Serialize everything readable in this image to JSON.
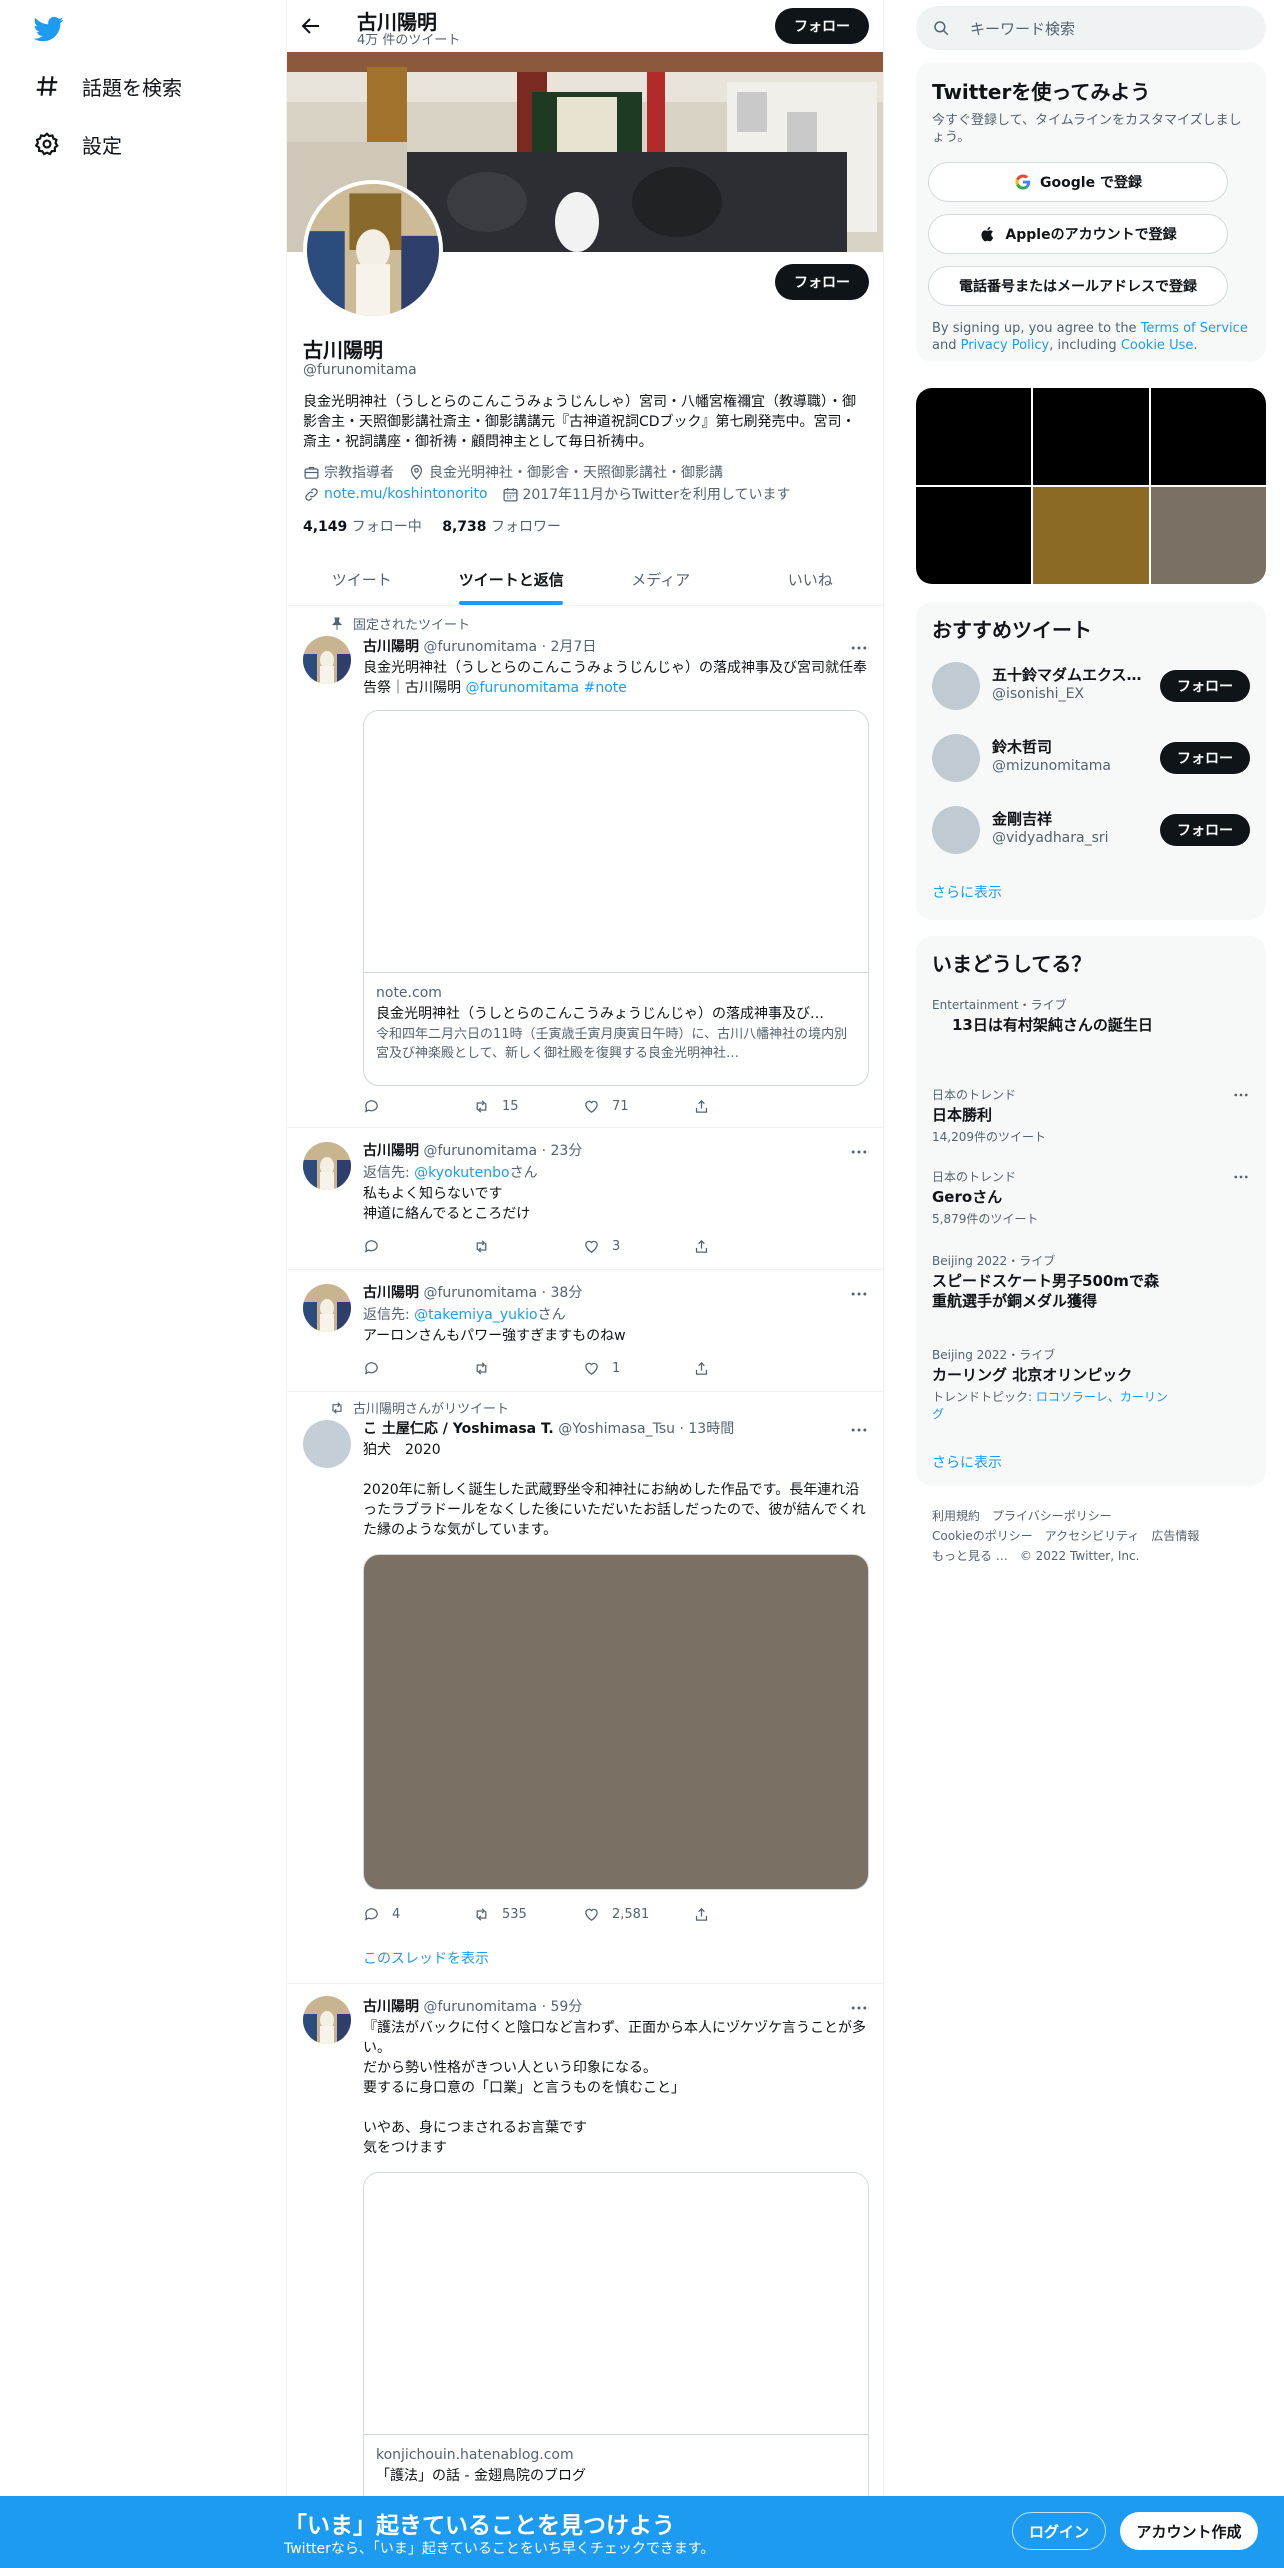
{
  "colors": {
    "accent": "#1d9bf0",
    "text": "#0f1419",
    "muted": "#536471",
    "button_dark": "#0f1419"
  },
  "nav": {
    "logo_icon": "twitter-bird-icon",
    "items": [
      {
        "label": "話題を検索",
        "icon": "hashtag-icon"
      },
      {
        "label": "設定",
        "icon": "gear-icon"
      }
    ]
  },
  "header": {
    "name": "古川陽明",
    "tweet_count": "4万 件のツイート",
    "follow_label": "フォロー"
  },
  "profile": {
    "name": "古川陽明",
    "handle": "@furunomitama",
    "follow_label": "フォロー",
    "bio": "良金光明神社（うしとらのこんこうみょうじんしゃ）宮司・八幡宮権禰宜（教導職）・御影舎主・天照御影講社斎主・御影講講元『古神道祝詞CDブック』第七刷発売中。宮司・斎主・祝詞講座・御祈祷・顧問神主として毎日祈祷中。",
    "category": "宗教指導者",
    "location": "良金光明神社・御影舎・天照御影講社・御影講",
    "website": "note.mu/koshintonorito",
    "joined": "2017年11月からTwitterを利用しています",
    "following_count": "4,149",
    "following_label": "フォロー中",
    "followers_count": "8,738",
    "followers_label": "フォロワー"
  },
  "tabs": [
    {
      "label": "ツイート",
      "active": false
    },
    {
      "label": "ツイートと返信",
      "active": true
    },
    {
      "label": "メディア",
      "active": false
    },
    {
      "label": "いいね",
      "active": false
    }
  ],
  "tweets": [
    {
      "context": "固定されたツイート",
      "name": "古川陽明",
      "handle": "@furunomitama",
      "time": "2月7日",
      "text_plain": "良金光明神社（うしとらのこんこうみょうじんじゃ）の落成神事及び宮司就任奉告祭｜古川陽明 ",
      "text_links": "@furunomitama #note",
      "card": {
        "domain": "note.com",
        "title": "良金光明神社（うしとらのこんこうみょうじんじゃ）の落成神事及び…",
        "desc": "令和四年二月六日の11時（壬寅歳壬寅月庚寅日午時）に、古川八幡神社の境内別宮及び神楽殿として、新しく御社殿を復興する良金光明神社…"
      },
      "replies": "",
      "retweets": "15",
      "likes": "71"
    },
    {
      "name": "古川陽明",
      "handle": "@furunomitama",
      "time": "23分",
      "reply_prefix": "返信先: ",
      "reply_to": "@kyokutenbo",
      "reply_suffix": "さん",
      "line1": "私もよく知らないです",
      "line2": "神道に絡んでるところだけ",
      "replies": "",
      "retweets": "",
      "likes": "3"
    },
    {
      "name": "古川陽明",
      "handle": "@furunomitama",
      "time": "38分",
      "reply_prefix": "返信先: ",
      "reply_to": "@takemiya_yukio",
      "reply_suffix": "さん",
      "line1": "アーロンさんもパワー強すぎますものねw",
      "replies": "",
      "retweets": "",
      "likes": "1"
    },
    {
      "context": "古川陽明さんがリツイート",
      "name": "こ 土屋仁応 / Yoshimasa T.",
      "handle": "@Yoshimasa_Tsu",
      "time": "13時間",
      "line1": "狛犬　2020",
      "line2": "2020年に新しく誕生した武蔵野坐令和神社にお納めした作品です。長年連れ沿ったラブラドールをなくした後にいただいたお話しだったので、彼が結んでくれた縁のような気がしています。",
      "replies": "4",
      "retweets": "535",
      "likes": "2,581",
      "thread": "このスレッドを表示"
    },
    {
      "name": "古川陽明",
      "handle": "@furunomitama",
      "time": "59分",
      "text": "『護法がバックに付くと陰口など言わず、正面から本人にヅケヅケ言うことが多い。\nだから勢い性格がきつい人という印象になる。\n要するに身口意の「口業」と言うものを慎むこと」\n\nいやあ、身につまされるお言葉です\n気をつけます",
      "card": {
        "domain": "konjichouin.hatenablog.com",
        "title": "「護法」の話 - 金翅鳥院のブログ"
      }
    }
  ],
  "right": {
    "search_placeholder": "キーワード検索",
    "signup": {
      "title": "Twitterを使ってみよう",
      "sub": "今すぐ登録して、タイムラインをカスタマイズしましょう。",
      "google": "Google で登録",
      "apple": "Appleのアカウントで登録",
      "phone": "電話番号またはメールアドレスで登録",
      "terms_pre": "By signing up, you agree to the ",
      "terms_link": "Terms of Service",
      "terms_mid": " and ",
      "privacy_link": "Privacy Policy",
      "terms_mid2": ", including ",
      "cookie_link": "Cookie Use",
      "terms_end": "."
    },
    "recommend": {
      "title": "おすすめツイート",
      "follow_label": "フォロー",
      "users": [
        {
          "name": "五十鈴マダムエクス…",
          "handle": "@isonishi_EX"
        },
        {
          "name": "鈴木哲司",
          "handle": "@mizunomitama"
        },
        {
          "name": "金剛吉祥",
          "handle": "@vidyadhara_sri"
        }
      ],
      "more": "さらに表示"
    },
    "trends": {
      "title": "いまどうしてる？",
      "items": [
        {
          "category": "Entertainment・ライブ",
          "title": "13日は有村架純さんの誕生日"
        },
        {
          "category": "日本のトレンド",
          "title": "日本勝利",
          "count": "14,209件のツイート"
        },
        {
          "category": "日本のトレンド",
          "title": "Geroさん",
          "count": "5,879件のツイート"
        },
        {
          "category": "Beijing 2022・ライブ",
          "title": "スピードスケート男子500mで森重航選手が銅メダル獲得"
        },
        {
          "category": "Beijing 2022・ライブ",
          "title": "カーリング 北京オリンピック",
          "topic_label": "トレンドトピック: ",
          "topic": "ロコソラーレ、カーリング"
        }
      ],
      "more": "さらに表示"
    },
    "footer": {
      "line1": [
        "利用規約",
        "プライバシーポリシー"
      ],
      "line2": [
        "Cookieのポリシー",
        "アクセシビリティ",
        "広告情報"
      ],
      "line3": [
        "もっと見る …",
        "© 2022 Twitter, Inc."
      ]
    }
  },
  "bottombar": {
    "title": "「いま」起きていることを見つけよう",
    "sub": "Twitterなら、「いま」起きていることをいち早くチェックできます。",
    "login": "ログイン",
    "signup": "アカウント作成"
  }
}
